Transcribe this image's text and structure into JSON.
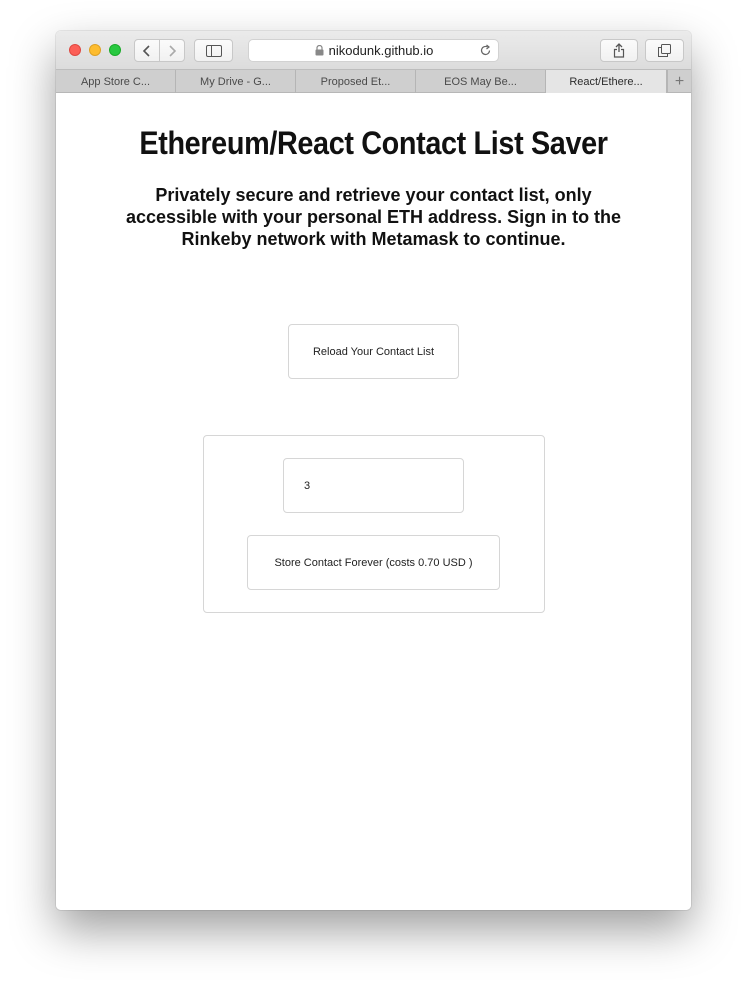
{
  "browser": {
    "address": "nikodunk.github.io",
    "tabs": [
      {
        "label": "App Store C..."
      },
      {
        "label": "My Drive - G..."
      },
      {
        "label": "Proposed Et..."
      },
      {
        "label": "EOS May Be..."
      },
      {
        "label": "React/Ethere..."
      }
    ],
    "icons": {
      "back": "chevron-left-icon",
      "forward": "chevron-right-icon",
      "sidebar": "sidebar-icon",
      "share": "share-icon",
      "tabs": "tabs-overview-icon",
      "lock": "lock-icon",
      "reload": "reload-icon",
      "new_tab": "plus-icon"
    }
  },
  "page": {
    "title": "Ethereum/React Contact List Saver",
    "subtitle": "Privately secure and retrieve your contact list, only accessible with your personal ETH address. Sign in to the Rinkeby network with Metamask to continue.",
    "reload_button": "Reload Your Contact List",
    "contact_input_value": "3",
    "store_button": "Store Contact Forever (costs 0.70 USD )"
  }
}
